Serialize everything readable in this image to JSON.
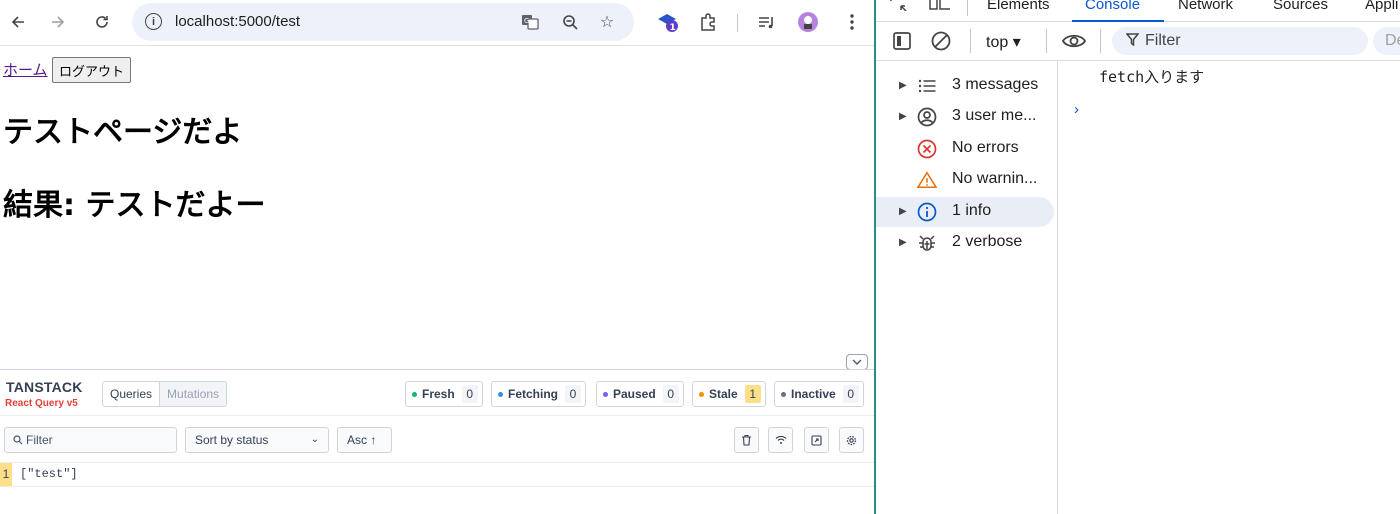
{
  "browser": {
    "url": "localhost:5000/test",
    "extension_badge": "1"
  },
  "page": {
    "home_link": "ホーム",
    "logout_button": "ログアウト",
    "title": "テストページだよ",
    "result": "結果: テストだよー"
  },
  "react_query": {
    "logo_top": "TANSTACK",
    "logo_bottom": "React Query v5",
    "tabs": [
      "Queries",
      "Mutations"
    ],
    "stats": [
      {
        "label": "Fresh",
        "count": "0",
        "color": "#12b76a"
      },
      {
        "label": "Fetching",
        "count": "0",
        "color": "#2e90fa"
      },
      {
        "label": "Paused",
        "count": "0",
        "color": "#7a5af8"
      },
      {
        "label": "Stale",
        "count": "1",
        "color": "#f79009"
      },
      {
        "label": "Inactive",
        "count": "0",
        "color": "#667085"
      }
    ],
    "filter_placeholder": "Filter",
    "sort_label": "Sort by status",
    "order_label": "Asc ↑",
    "query": {
      "observers": "1",
      "key": "[\"test\"]"
    }
  },
  "devtools": {
    "tabs": [
      "Elements",
      "Console",
      "Network",
      "Sources",
      "Appli"
    ],
    "active_tab": "Console",
    "context": "top ▾",
    "filter_placeholder": "Filter",
    "level_placeholder": "De",
    "sidebar": [
      {
        "label": "3 messages",
        "icon": "list-icon",
        "expandable": true
      },
      {
        "label": "3 user me...",
        "icon": "user-circle-icon",
        "expandable": true
      },
      {
        "label": "No errors",
        "icon": "error-icon",
        "expandable": false
      },
      {
        "label": "No warnin...",
        "icon": "warning-icon",
        "expandable": false
      },
      {
        "label": "1 info",
        "icon": "info-icon",
        "expandable": true,
        "selected": true
      },
      {
        "label": "2 verbose",
        "icon": "bug-icon",
        "expandable": true
      }
    ],
    "console_message": "fetch入ります",
    "prompt": "›"
  }
}
